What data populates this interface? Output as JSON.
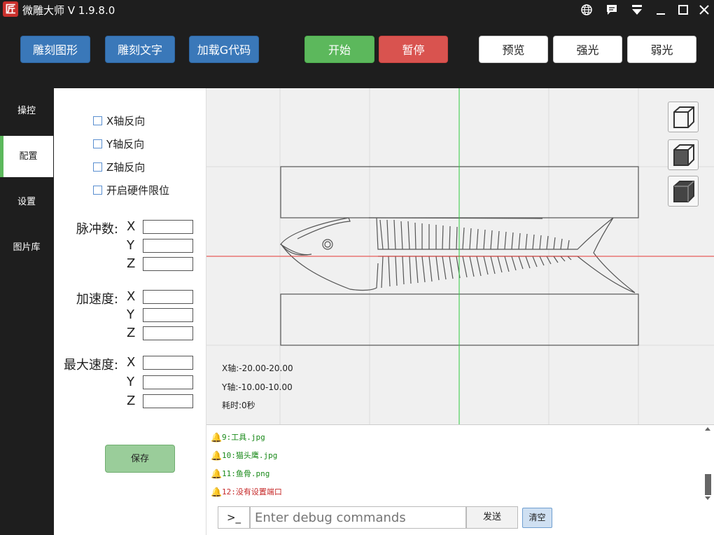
{
  "titlebar": {
    "logo_text": "匠",
    "title": "微雕大师 V 1.9.8.0",
    "icons": [
      "globe-icon",
      "message-icon",
      "dropdown-icon",
      "minimize-icon",
      "maximize-icon",
      "close-icon"
    ]
  },
  "toolbar": {
    "engrave_image": "雕刻图形",
    "engrave_text": "雕刻文字",
    "load_gcode": "加载G代码",
    "start": "开始",
    "pause": "暂停",
    "preview": "预览",
    "strong_light": "强光",
    "weak_light": "弱光"
  },
  "sidenav": {
    "items": [
      {
        "label": "操控",
        "active": false
      },
      {
        "label": "配置",
        "active": true
      },
      {
        "label": "设置",
        "active": false
      },
      {
        "label": "图片库",
        "active": false
      }
    ]
  },
  "config": {
    "invert_x": "X轴反向",
    "invert_y": "Y轴反向",
    "invert_z": "Z轴反向",
    "hw_limit": "开启硬件限位",
    "pulses_label": "脉冲数:",
    "accel_label": "加速度:",
    "maxspeed_label": "最大速度:",
    "axes": [
      "X",
      "Y",
      "Z"
    ],
    "save": "保存"
  },
  "canvas": {
    "x_axis": "X轴:-20.00-20.00",
    "y_axis": "Y轴:-10.00-10.00",
    "time": "耗时:0秒",
    "colors": {
      "x_axis_line": "#e53935",
      "y_axis_line": "#2ecc40"
    }
  },
  "log": {
    "lines": [
      {
        "text": "9:工具.jpg",
        "color": "#1a8a1a"
      },
      {
        "text": "10:猫头鹰.jpg",
        "color": "#1a8a1a"
      },
      {
        "text": "11:鱼骨.png",
        "color": "#1a8a1a"
      },
      {
        "text": "12:没有设置端口",
        "color": "#c62828"
      }
    ],
    "prompt": ">_",
    "placeholder": "Enter debug commands",
    "send": "发送",
    "clear": "清空"
  }
}
